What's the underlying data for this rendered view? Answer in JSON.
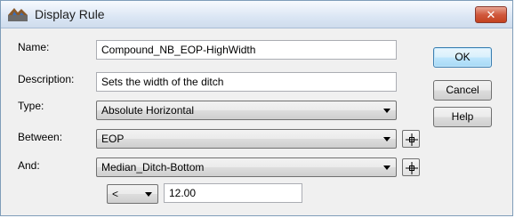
{
  "window": {
    "title": "Display Rule",
    "close_glyph": "✕"
  },
  "form": {
    "name_label": "Name:",
    "name_value": "Compound_NB_EOP-HighWidth",
    "description_label": "Description:",
    "description_value": "Sets the width of the ditch",
    "type_label": "Type:",
    "type_value": "Absolute Horizontal",
    "between_label": "Between:",
    "between_value": "EOP",
    "and_label": "And:",
    "and_value": "Median_Ditch-Bottom",
    "operator_value": "<",
    "distance_value": "12.00"
  },
  "buttons": {
    "ok": "OK",
    "cancel": "Cancel",
    "help": "Help"
  },
  "icons": {
    "app": "display-rule-app-icon",
    "close": "close-icon",
    "pick": "crosshair-pick-icon",
    "dropdown": "chevron-down-icon"
  },
  "colors": {
    "accent": "#3c7fb1",
    "close": "#c4421f"
  }
}
